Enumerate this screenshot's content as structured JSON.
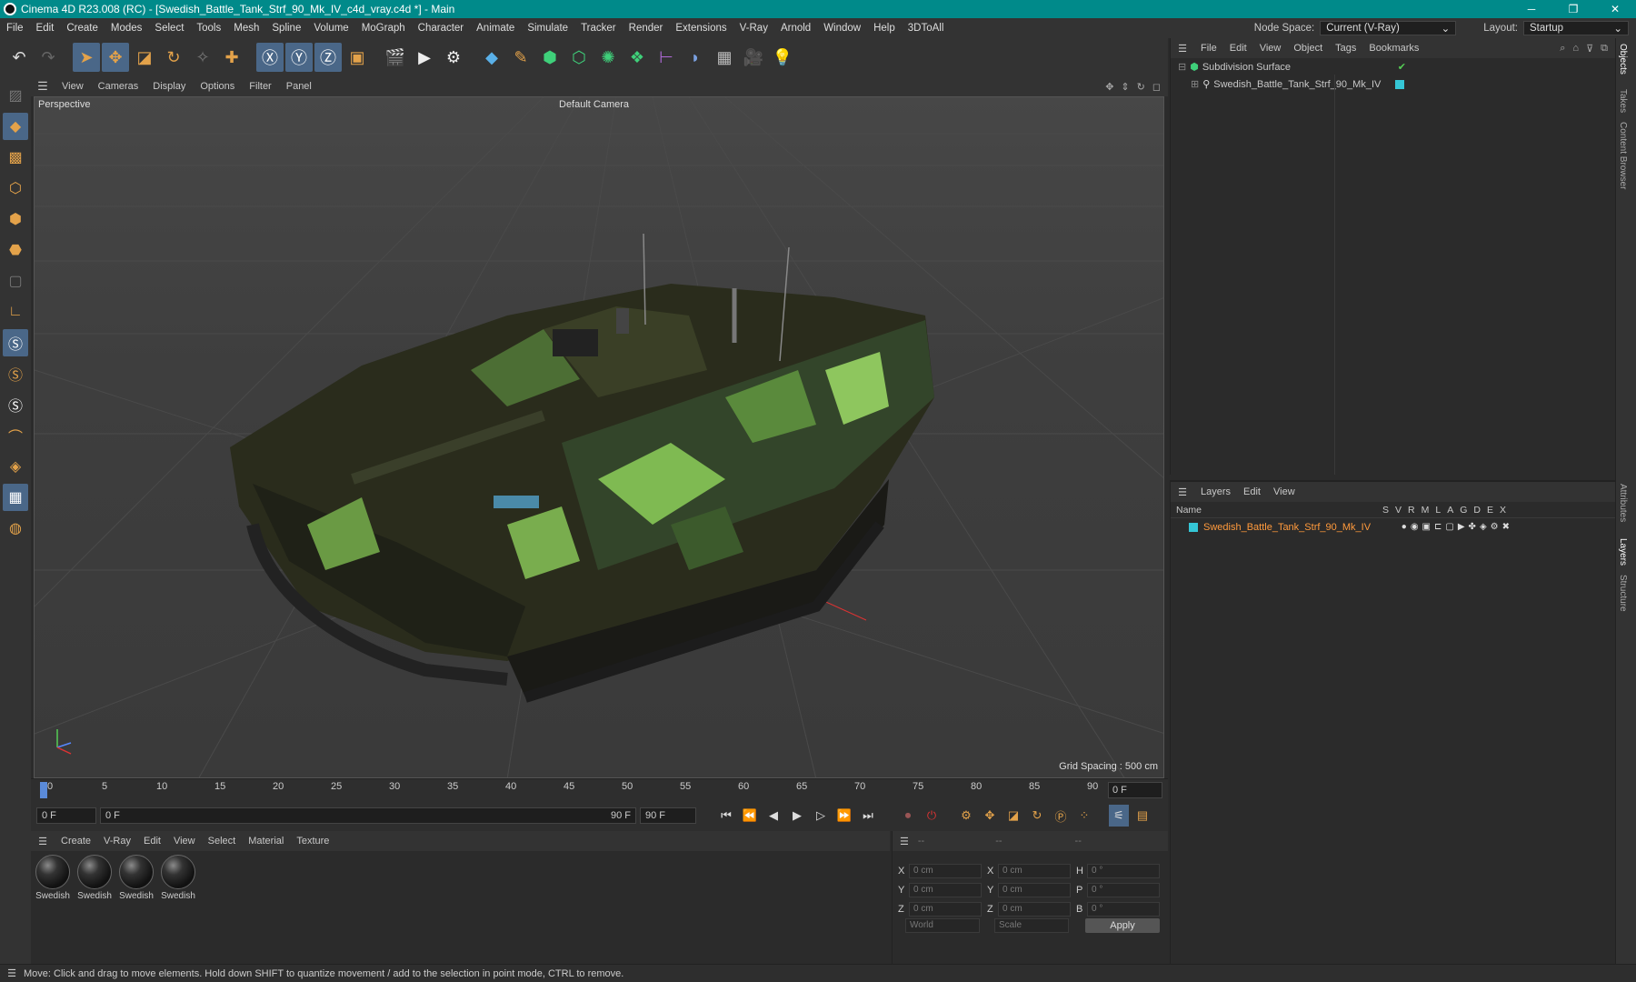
{
  "window": {
    "title": "Cinema 4D R23.008 (RC) - [Swedish_Battle_Tank_Strf_90_Mk_IV_c4d_vray.c4d *] - Main",
    "minimize": "─",
    "restore": "❐",
    "close": "✕"
  },
  "menubar": {
    "items": [
      "File",
      "Edit",
      "Create",
      "Modes",
      "Select",
      "Tools",
      "Mesh",
      "Spline",
      "Volume",
      "MoGraph",
      "Character",
      "Animate",
      "Simulate",
      "Tracker",
      "Render",
      "Extensions",
      "V-Ray",
      "Arnold",
      "Window",
      "Help",
      "3DToAll"
    ],
    "node_space_label": "Node Space:",
    "node_space_value": "Current (V-Ray)",
    "layout_label": "Layout:",
    "layout_value": "Startup"
  },
  "viewport": {
    "menu": [
      "View",
      "Cameras",
      "Display",
      "Options",
      "Filter",
      "Panel"
    ],
    "label": "Perspective",
    "camera": "Default Camera",
    "grid_spacing": "Grid Spacing : 500 cm"
  },
  "timeline": {
    "ticks": [
      "0",
      "5",
      "10",
      "15",
      "20",
      "25",
      "30",
      "35",
      "40",
      "45",
      "50",
      "55",
      "60",
      "65",
      "70",
      "75",
      "80",
      "85",
      "90"
    ],
    "current": "0 F"
  },
  "transport": {
    "start": "0 F",
    "range_start": "0 F",
    "range_end": "90 F",
    "end": "90 F"
  },
  "materials": {
    "menu": [
      "Create",
      "V-Ray",
      "Edit",
      "View",
      "Select",
      "Material",
      "Texture"
    ],
    "items": [
      "Swedish",
      "Swedish",
      "Swedish",
      "Swedish"
    ]
  },
  "coords": {
    "header": [
      "--",
      "--",
      "--"
    ],
    "rows": [
      {
        "a": "X",
        "av": "0 cm",
        "b": "X",
        "bv": "0 cm",
        "c": "H",
        "cv": "0 °"
      },
      {
        "a": "Y",
        "av": "0 cm",
        "b": "Y",
        "bv": "0 cm",
        "c": "P",
        "cv": "0 °"
      },
      {
        "a": "Z",
        "av": "0 cm",
        "b": "Z",
        "bv": "0 cm",
        "c": "B",
        "cv": "0 °"
      }
    ],
    "world": "World",
    "scale": "Scale",
    "apply": "Apply"
  },
  "objects": {
    "menu": [
      "File",
      "Edit",
      "View",
      "Object",
      "Tags",
      "Bookmarks"
    ],
    "items": [
      {
        "name": "Subdivision Surface"
      },
      {
        "name": "Swedish_Battle_Tank_Strf_90_Mk_IV"
      }
    ]
  },
  "layers": {
    "menu": [
      "Layers",
      "Edit",
      "View"
    ],
    "name_col": "Name",
    "cols": [
      "S",
      "V",
      "R",
      "M",
      "L",
      "A",
      "G",
      "D",
      "E",
      "X"
    ],
    "items": [
      {
        "name": "Swedish_Battle_Tank_Strf_90_Mk_IV"
      }
    ]
  },
  "sidetabs": [
    "Objects",
    "Takes",
    "Content Browser",
    "Attributes",
    "Layers",
    "Structure"
  ],
  "status": "Move: Click and drag to move elements. Hold down SHIFT to quantize movement / add to the selection in point mode, CTRL to remove.",
  "colors": {
    "accent": "#008a8a",
    "layer": "#ff9a3c",
    "layer_swatch": "#35c6d6"
  }
}
